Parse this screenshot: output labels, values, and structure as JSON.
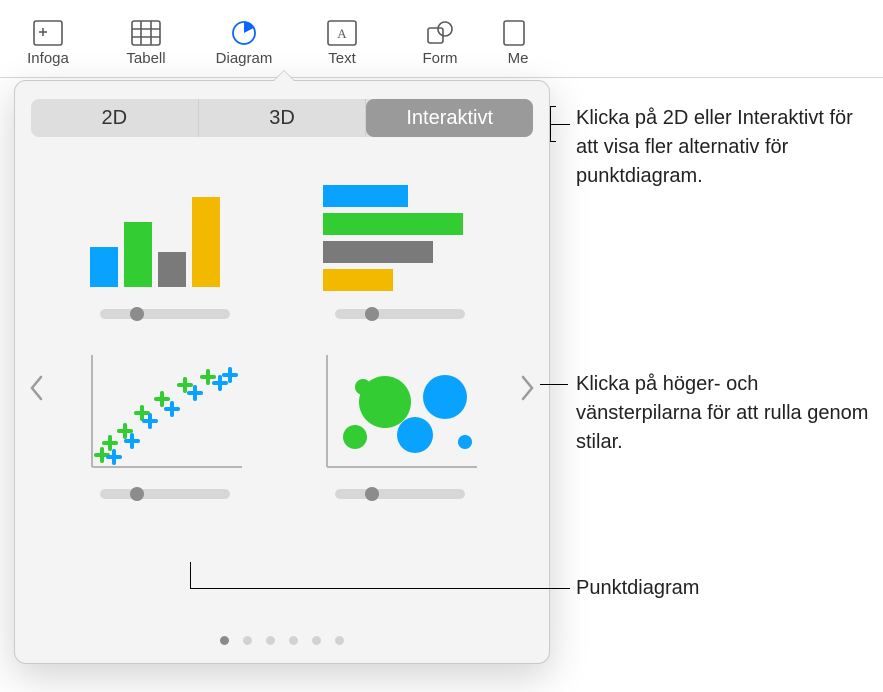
{
  "toolbar": {
    "items": [
      {
        "label": "Infoga"
      },
      {
        "label": "Tabell"
      },
      {
        "label": "Diagram"
      },
      {
        "label": "Text"
      },
      {
        "label": "Form"
      },
      {
        "label": "Me"
      }
    ]
  },
  "popover": {
    "tabs": {
      "a": "2D",
      "b": "3D",
      "c": "Interaktivt"
    },
    "page_dots": 6,
    "active_dot": 0
  },
  "annotations": {
    "tabs_note": "Klicka på 2D eller Interaktivt för att visa fler alternativ för punktdiagram.",
    "arrows_note": "Klicka på höger- och vänsterpilarna för att rulla genom stilar.",
    "scatter_note": "Punktdiagram"
  }
}
